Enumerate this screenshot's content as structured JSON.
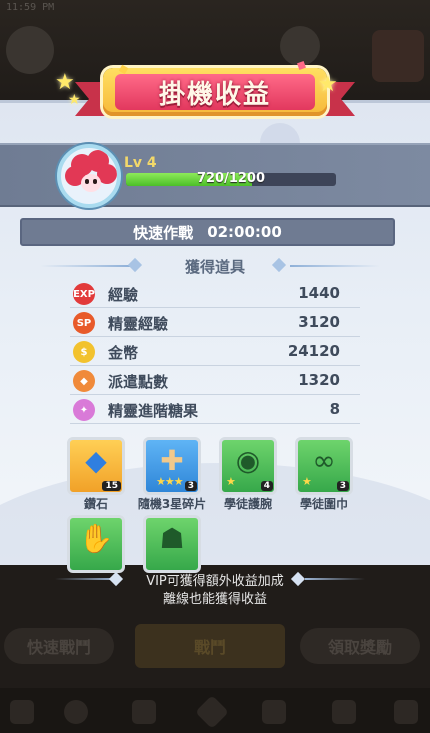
{
  "status_bar": {
    "time": "11:59 PM"
  },
  "banner": {
    "title": "掛機收益"
  },
  "player": {
    "level_label": "Lv 4",
    "xp_text": "720/1200",
    "xp_fraction": 0.6
  },
  "quick_battle": {
    "label": "快速作戰",
    "time": "02:00:00"
  },
  "section": {
    "title": "獲得道具"
  },
  "rewards": [
    {
      "icon": "exp-icon",
      "label": "經驗",
      "value": "1440",
      "color": "#e23a3a"
    },
    {
      "icon": "sprite-exp-icon",
      "label": "精靈經驗",
      "value": "3120",
      "color": "#e85a2a"
    },
    {
      "icon": "coin-icon",
      "label": "金幣",
      "value": "24120",
      "color": "#f2c22e"
    },
    {
      "icon": "dispatch-points-icon",
      "label": "派遣點數",
      "value": "1320",
      "color": "#f08a3a"
    },
    {
      "icon": "candy-icon",
      "label": "精靈進階糖果",
      "value": "8",
      "color": "#d97ad8"
    }
  ],
  "items": [
    {
      "label": "鑽石",
      "count": "15",
      "style": "gold",
      "icon": "diamond-icon"
    },
    {
      "label": "隨機3星碎片",
      "count": "3",
      "style": "blue",
      "icon": "puzzle-piece-icon"
    },
    {
      "label": "學徒護腕",
      "count": "4",
      "style": "green",
      "icon": "bracer-icon"
    },
    {
      "label": "學徒圍巾",
      "count": "3",
      "style": "green",
      "icon": "scarf-icon"
    },
    {
      "label": "",
      "count": "",
      "style": "green",
      "icon": "gloves-icon"
    },
    {
      "label": "",
      "count": "",
      "style": "green",
      "icon": "helmet-icon"
    }
  ],
  "footer": {
    "vip_text": "VIP可獲得額外收益加成",
    "offline_text": "離線也能獲得收益"
  },
  "background": {
    "left_button": "快速戰鬥",
    "center_button": "戰鬥",
    "right_button": "領取獎勵"
  }
}
